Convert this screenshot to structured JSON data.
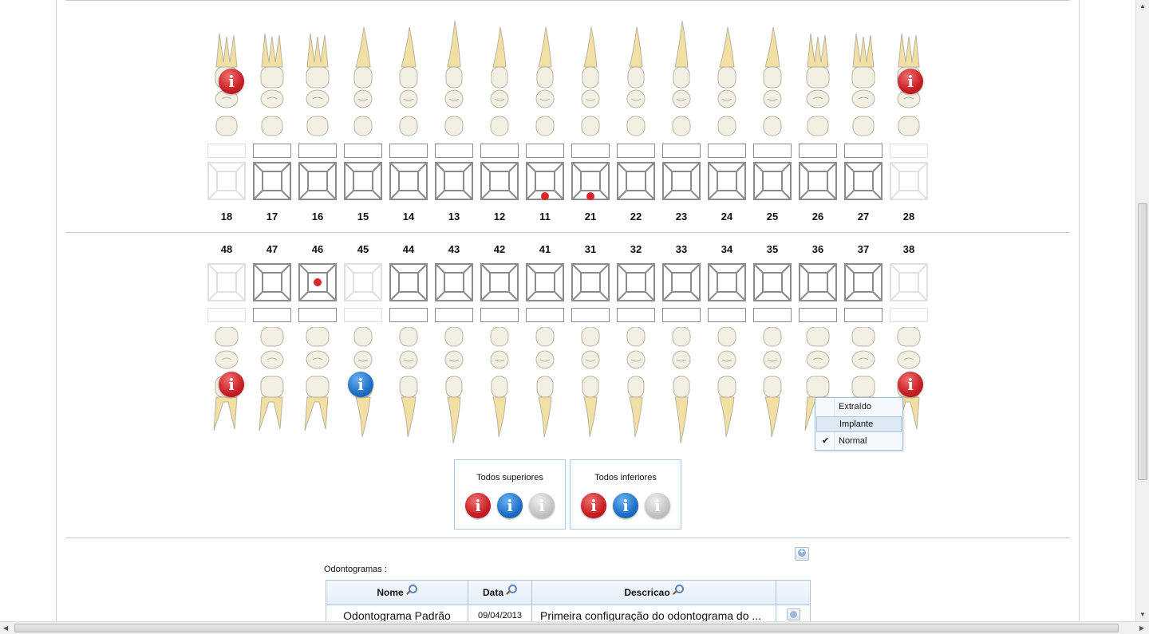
{
  "upper_arch": {
    "teeth": [
      {
        "number": "18",
        "present": false,
        "badge": "red",
        "dot": false
      },
      {
        "number": "17",
        "present": true,
        "badge": "",
        "dot": false
      },
      {
        "number": "16",
        "present": true,
        "badge": "",
        "dot": false
      },
      {
        "number": "15",
        "present": true,
        "badge": "",
        "dot": false
      },
      {
        "number": "14",
        "present": true,
        "badge": "",
        "dot": false
      },
      {
        "number": "13",
        "present": true,
        "badge": "",
        "dot": false
      },
      {
        "number": "12",
        "present": true,
        "badge": "",
        "dot": false
      },
      {
        "number": "11",
        "present": true,
        "badge": "",
        "dot": true
      },
      {
        "number": "21",
        "present": true,
        "badge": "",
        "dot": true
      },
      {
        "number": "22",
        "present": true,
        "badge": "",
        "dot": false
      },
      {
        "number": "23",
        "present": true,
        "badge": "",
        "dot": false
      },
      {
        "number": "24",
        "present": true,
        "badge": "",
        "dot": false
      },
      {
        "number": "25",
        "present": true,
        "badge": "",
        "dot": false
      },
      {
        "number": "26",
        "present": true,
        "badge": "",
        "dot": false
      },
      {
        "number": "27",
        "present": true,
        "badge": "",
        "dot": false
      },
      {
        "number": "28",
        "present": false,
        "badge": "red",
        "dot": false
      }
    ]
  },
  "lower_arch": {
    "teeth": [
      {
        "number": "48",
        "present": false,
        "badge": "red",
        "dot": false
      },
      {
        "number": "47",
        "present": true,
        "badge": "",
        "dot": false
      },
      {
        "number": "46",
        "present": true,
        "badge": "",
        "dot": true
      },
      {
        "number": "45",
        "present": false,
        "badge": "blue",
        "dot": false
      },
      {
        "number": "44",
        "present": true,
        "badge": "",
        "dot": false
      },
      {
        "number": "43",
        "present": true,
        "badge": "",
        "dot": false
      },
      {
        "number": "42",
        "present": true,
        "badge": "",
        "dot": false
      },
      {
        "number": "41",
        "present": true,
        "badge": "",
        "dot": false
      },
      {
        "number": "31",
        "present": true,
        "badge": "",
        "dot": false
      },
      {
        "number": "32",
        "present": true,
        "badge": "",
        "dot": false
      },
      {
        "number": "33",
        "present": true,
        "badge": "",
        "dot": false
      },
      {
        "number": "34",
        "present": true,
        "badge": "",
        "dot": false
      },
      {
        "number": "35",
        "present": true,
        "badge": "",
        "dot": false
      },
      {
        "number": "36",
        "present": true,
        "badge": "",
        "dot": false
      },
      {
        "number": "37",
        "present": true,
        "badge": "",
        "dot": false
      },
      {
        "number": "38",
        "present": false,
        "badge": "red",
        "dot": false
      }
    ]
  },
  "context_menu": {
    "items": [
      {
        "label": "Extraído",
        "checked": false,
        "hover": false
      },
      {
        "label": "Implante",
        "checked": false,
        "hover": true
      },
      {
        "label": "Normal",
        "checked": true,
        "hover": false
      }
    ]
  },
  "groups": {
    "upper_label": "Todos superiores",
    "lower_label": "Todos inferiores",
    "badge_icons": [
      "red-info-icon",
      "blue-info-icon",
      "gray-info-icon"
    ]
  },
  "odontogramas": {
    "section_label": "Odontogramas :",
    "columns": [
      "Nome",
      "Data",
      "Descricao"
    ],
    "rows": [
      {
        "nome": "Odontograma Padrão",
        "data": "09/04/2013",
        "descricao": "Primeira configuração do odontograma do ..."
      }
    ]
  },
  "colors": {
    "badge_red": "#c71e24",
    "badge_blue": "#1f6fc6",
    "badge_gray": "#c3c3c3",
    "divider": "#b9cde3",
    "tooth_fill": "#f3efe2",
    "root_fill": "#f2dfa3"
  }
}
